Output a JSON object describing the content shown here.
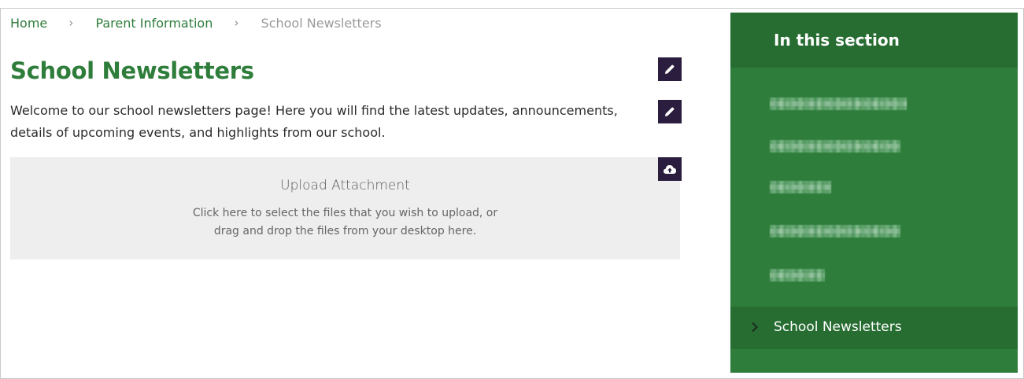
{
  "breadcrumb": {
    "home": "Home",
    "separator": "›",
    "parent": "Parent Information",
    "current": "School Newsletters"
  },
  "page": {
    "title": "School Newsletters",
    "intro": "Welcome to our school newsletters page! Here you will find the latest updates, announcements, details of upcoming events, and highlights from our school."
  },
  "upload": {
    "title": "Upload Attachment",
    "description": "Click here to select the files that you wish to upload, or drag and drop the files from your desktop here."
  },
  "edit_controls": {
    "title_edit_icon": "pencil-icon",
    "intro_edit_icon": "pencil-icon",
    "upload_icon": "cloud-upload-icon"
  },
  "sidebar": {
    "header": "In this section",
    "active_item": "School Newsletters",
    "active_icon": "chevron-right-icon"
  },
  "colors": {
    "brand_green": "#2e7d3a",
    "sidebar_dark": "#276d32",
    "edit_button": "#2a1d3d",
    "upload_bg": "#eeeeee"
  }
}
